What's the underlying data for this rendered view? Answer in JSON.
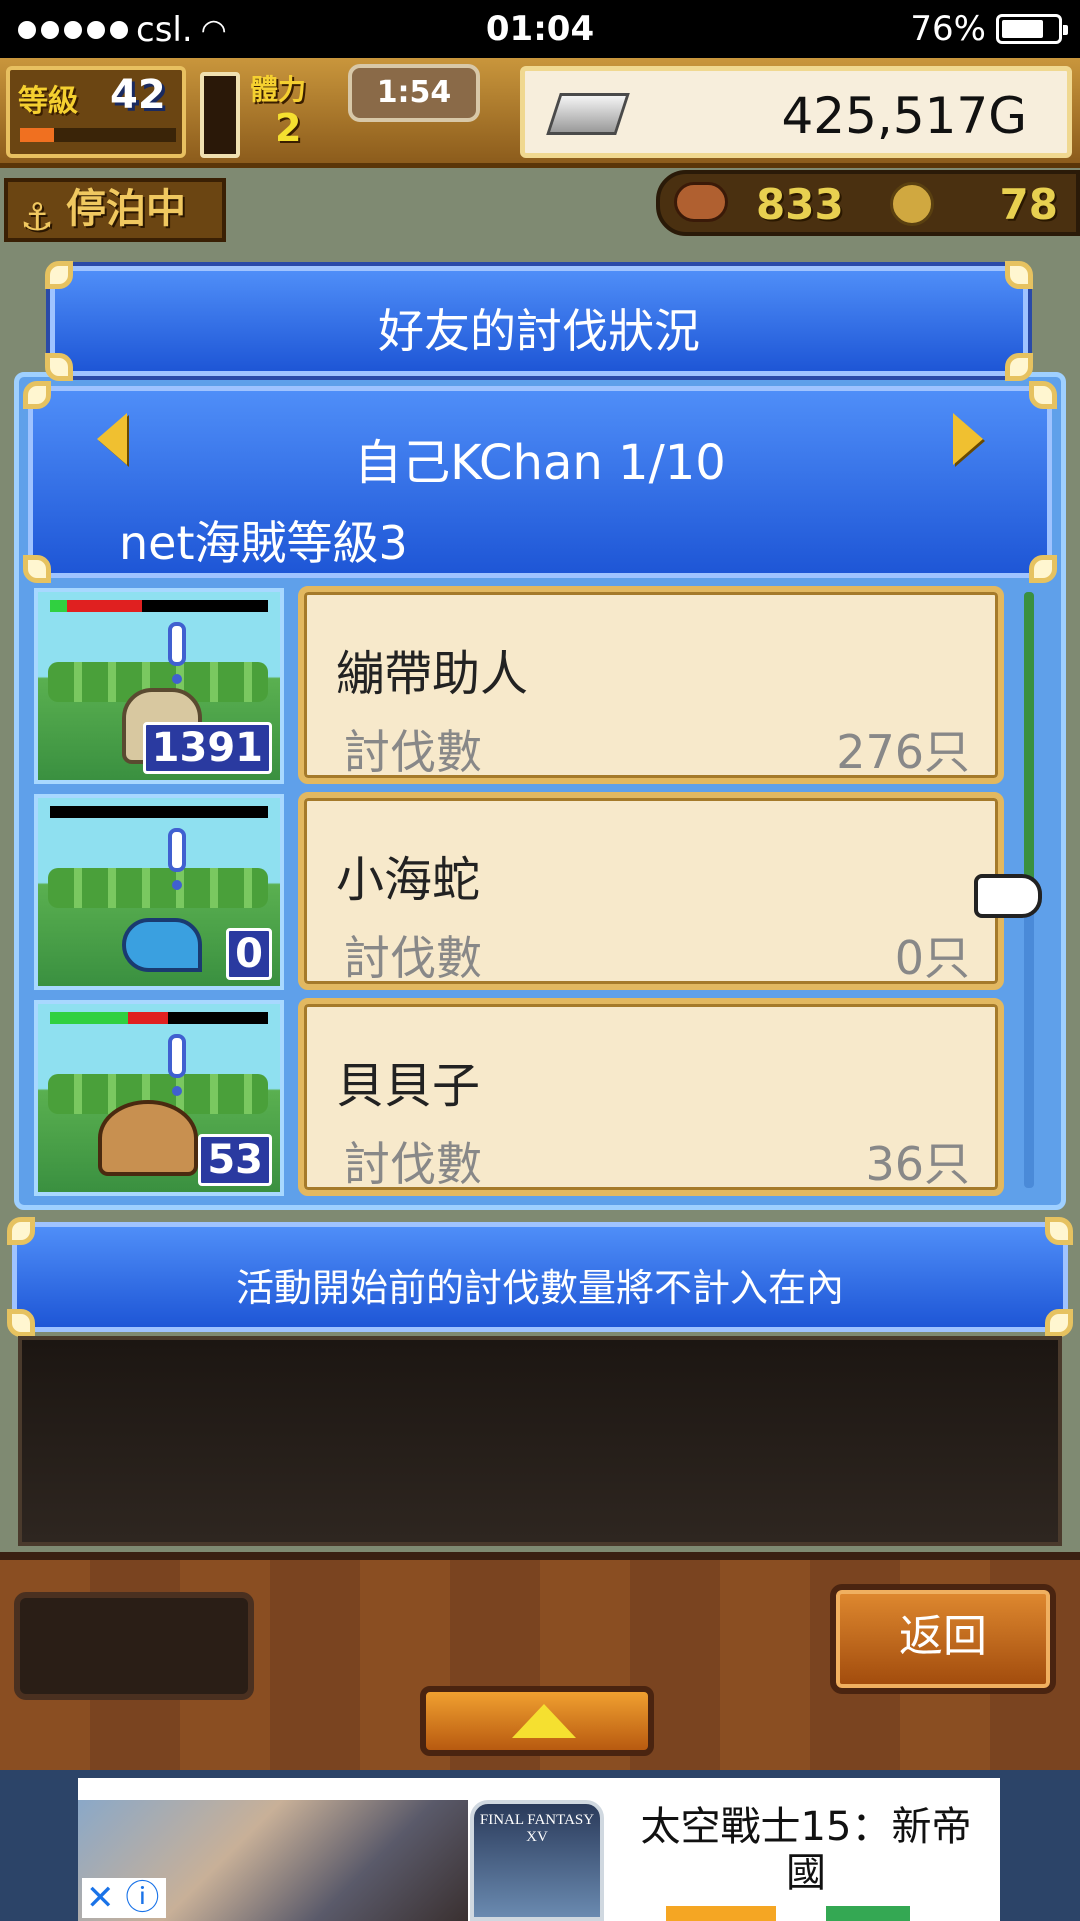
{
  "status_bar": {
    "carrier": "csl.",
    "time": "01:04",
    "battery": "76%",
    "battery_level": 0.76
  },
  "hud": {
    "level_label": "等級",
    "level_value": "42",
    "level_progress": 0.22,
    "stamina_label": "體力",
    "stamina_value": "2",
    "timer": "1:54",
    "gold": "425,517G",
    "docked_label": "停泊中",
    "food": "833",
    "coins": "78"
  },
  "dialog": {
    "title": "好友的討伐狀況",
    "player": "自己KChan 1/10",
    "rank": "net海賊等級3",
    "notice": "活動開始前的討伐數量將不計入在內"
  },
  "monsters": [
    {
      "name": "繃帶助人",
      "label": "討伐數",
      "value": "276只",
      "count": "1391",
      "hp_green": 0.08,
      "hp_red": 0.34,
      "sprite": "mummy"
    },
    {
      "name": "小海蛇",
      "label": "討伐數",
      "value": "0只",
      "count": "0",
      "hp_green": 0,
      "hp_red": 0,
      "sprite": "sea-snake"
    },
    {
      "name": "貝貝子",
      "label": "討伐數",
      "value": "36只",
      "count": "53",
      "hp_green": 0.36,
      "hp_red": 0.18,
      "sprite": "hermit-crab"
    }
  ],
  "scroll": {
    "position": 0.0,
    "visible_fraction": 0.5
  },
  "buttons": {
    "back": "返回",
    "up": "up-arrow"
  },
  "ad": {
    "game_title": "FINAL FANTASY XV",
    "headline": "太空戰士15：新帝國",
    "close_icon": "close-icon",
    "info_icon": "info-icon"
  },
  "colors": {
    "banner_blue": "#1e56d6",
    "card_cream": "#f7e9cb",
    "gold_trim": "#e2b860",
    "wood": "#8a4e22"
  }
}
